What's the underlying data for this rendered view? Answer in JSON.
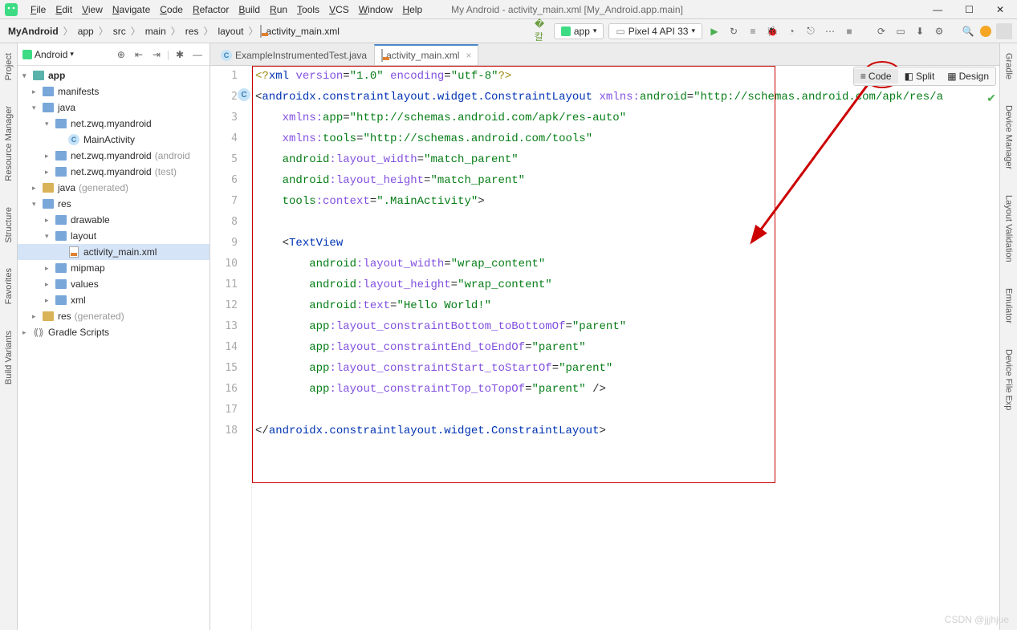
{
  "window": {
    "title": "My Android - activity_main.xml [My_Android.app.main]"
  },
  "menu": {
    "items": [
      "File",
      "Edit",
      "View",
      "Navigate",
      "Code",
      "Refactor",
      "Build",
      "Run",
      "Tools",
      "VCS",
      "Window",
      "Help"
    ]
  },
  "breadcrumb": {
    "items": [
      "MyAndroid",
      "app",
      "src",
      "main",
      "res",
      "layout",
      "activity_main.xml"
    ]
  },
  "run_config": "app",
  "device": "Pixel 4 API 33",
  "left_tabs": [
    "Project",
    "Resource Manager",
    "Structure",
    "Favorites",
    "Build Variants"
  ],
  "right_tabs": [
    "Gradle",
    "Device Manager",
    "Layout Validation",
    "Emulator",
    "Device File Exp"
  ],
  "sidebar": {
    "selector": "Android",
    "tree": [
      {
        "lvl": 0,
        "arrow": "▾",
        "icon": "folder-teal",
        "label": "app",
        "bold": true
      },
      {
        "lvl": 1,
        "arrow": "▸",
        "icon": "folder-blue",
        "label": "manifests"
      },
      {
        "lvl": 1,
        "arrow": "▾",
        "icon": "folder-blue",
        "label": "java"
      },
      {
        "lvl": 2,
        "arrow": "▾",
        "icon": "folder-blue",
        "label": "net.zwq.myandroid"
      },
      {
        "lvl": 3,
        "arrow": "",
        "icon": "class",
        "label": "MainActivity",
        "selected": false
      },
      {
        "lvl": 2,
        "arrow": "▸",
        "icon": "folder-blue",
        "label": "net.zwq.myandroid",
        "muted": "(android"
      },
      {
        "lvl": 2,
        "arrow": "▸",
        "icon": "folder-blue",
        "label": "net.zwq.myandroid",
        "muted": "(test)"
      },
      {
        "lvl": 1,
        "arrow": "▸",
        "icon": "folder",
        "label": "java",
        "muted": "(generated)"
      },
      {
        "lvl": 1,
        "arrow": "▾",
        "icon": "folder-blue",
        "label": "res"
      },
      {
        "lvl": 2,
        "arrow": "▸",
        "icon": "folder-blue",
        "label": "drawable"
      },
      {
        "lvl": 2,
        "arrow": "▾",
        "icon": "folder-blue",
        "label": "layout"
      },
      {
        "lvl": 3,
        "arrow": "",
        "icon": "xml",
        "label": "activity_main.xml",
        "selected": true
      },
      {
        "lvl": 2,
        "arrow": "▸",
        "icon": "folder-blue",
        "label": "mipmap"
      },
      {
        "lvl": 2,
        "arrow": "▸",
        "icon": "folder-blue",
        "label": "values"
      },
      {
        "lvl": 2,
        "arrow": "▸",
        "icon": "folder-blue",
        "label": "xml"
      },
      {
        "lvl": 1,
        "arrow": "▸",
        "icon": "folder",
        "label": "res",
        "muted": "(generated)"
      },
      {
        "lvl": 0,
        "arrow": "▸",
        "icon": "gradle",
        "label": "Gradle Scripts"
      }
    ]
  },
  "tabs": [
    {
      "label": "ExampleInstrumentedTest.java",
      "icon": "class",
      "active": false
    },
    {
      "label": "activity_main.xml",
      "icon": "xml",
      "active": true,
      "closable": true
    }
  ],
  "modes": {
    "code": "Code",
    "split": "Split",
    "design": "Design"
  },
  "editor": {
    "lines": [
      1,
      2,
      3,
      4,
      5,
      6,
      7,
      8,
      9,
      10,
      11,
      12,
      13,
      14,
      15,
      16,
      17,
      18
    ],
    "code_html": "<span class='t-pi'>&lt;?</span><span class='t-tag'>xml</span> <span class='t-attr'>version</span>=<span class='t-str'>\"1.0\"</span> <span class='t-attr'>encoding</span>=<span class='t-str'>\"utf-8\"</span><span class='t-pi'>?&gt;</span>\n&lt;<span class='t-tag'>androidx.constraintlayout.widget.ConstraintLayout</span> <span class='t-attr'>xmlns:</span><span class='t-ns'>android</span>=<span class='t-str'>\"http://schemas.android.com/apk/res/a</span>\n    <span class='t-attr'>xmlns:</span><span class='t-ns'>app</span>=<span class='t-str'>\"http://schemas.android.com/apk/res-auto\"</span>\n    <span class='t-attr'>xmlns:</span><span class='t-ns'>tools</span>=<span class='t-str'>\"http://schemas.android.com/tools\"</span>\n    <span class='t-ns'>android</span><span class='t-attr'>:layout_width</span>=<span class='t-str'>\"match_parent\"</span>\n    <span class='t-ns'>android</span><span class='t-attr'>:layout_height</span>=<span class='t-str'>\"match_parent\"</span>\n    <span class='t-ns'>tools</span><span class='t-attr'>:context</span>=<span class='t-str'>\".MainActivity\"</span>&gt;\n\n    &lt;<span class='t-tag'>TextView</span>\n        <span class='t-ns'>android</span><span class='t-attr'>:layout_width</span>=<span class='t-str'>\"wrap_content\"</span>\n        <span class='t-ns'>android</span><span class='t-attr'>:layout_height</span>=<span class='t-str'>\"wrap_content\"</span>\n        <span class='t-ns'>android</span><span class='t-attr'>:text</span>=<span class='t-str'>\"Hello World!\"</span>\n        <span class='t-ns'>app</span><span class='t-attr'>:layout_constraintBottom_toBottomOf</span>=<span class='t-str'>\"parent\"</span>\n        <span class='t-ns'>app</span><span class='t-attr'>:layout_constraintEnd_toEndOf</span>=<span class='t-str'>\"parent\"</span>\n        <span class='t-ns'>app</span><span class='t-attr'>:layout_constraintStart_toStartOf</span>=<span class='t-str'>\"parent\"</span>\n        <span class='t-ns'>app</span><span class='t-attr'>:layout_constraintTop_toTopOf</span>=<span class='t-str'>\"parent\"</span> /&gt;\n\n&lt;/<span class='t-tag'>androidx.constraintlayout.widget.ConstraintLayout</span>&gt;"
  },
  "watermark": "CSDN @jjjhjue"
}
